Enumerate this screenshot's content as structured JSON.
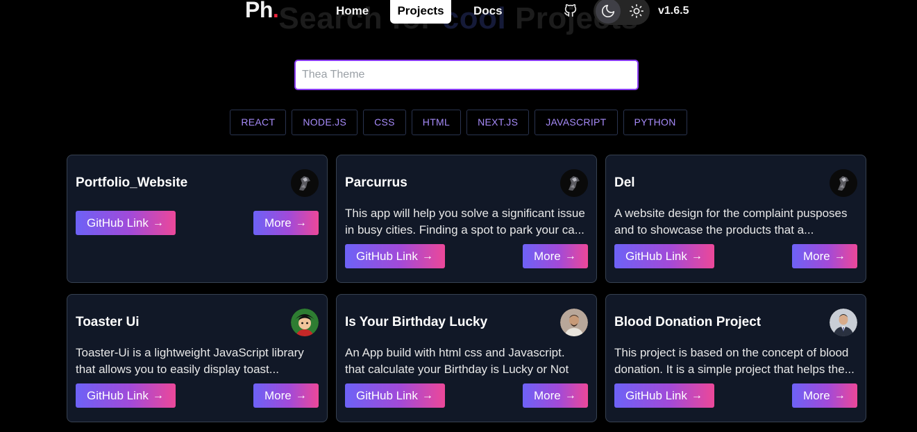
{
  "nav": {
    "logo": "Ph",
    "logo_dot": ".",
    "links": [
      "Home",
      "Projects",
      "Docs"
    ],
    "version": "v1.6.5"
  },
  "background_heading": {
    "part1": "Search for ",
    "part2": "cool",
    "part3": " Projects"
  },
  "search": {
    "placeholder": "Thea Theme",
    "value": ""
  },
  "tags": [
    "REACT",
    "NODE.JS",
    "CSS",
    "HTML",
    "NEXT.JS",
    "JAVASCRIPT",
    "PYTHON"
  ],
  "buttons": {
    "github": "GitHub Link",
    "more": "More",
    "arrow": "→"
  },
  "cards": [
    {
      "title": "Portfolio_Website",
      "description": "",
      "avatar": "dark-horse-avatar"
    },
    {
      "title": "Parcurrus",
      "description": "This app will help you solve a significant issue in busy cities. Finding a spot to park your ca...",
      "avatar": "dark-horse-avatar"
    },
    {
      "title": "Del",
      "description": "A website design for the complaint pusposes and to showcase the products that a...",
      "avatar": "dark-horse-avatar"
    },
    {
      "title": "Toaster Ui",
      "description": "Toaster-Ui is a lightweight JavaScript library that allows you to easily display toast...",
      "avatar": "anime-avatar"
    },
    {
      "title": "Is Your Birthday Lucky",
      "description": "An App build with html css and Javascript. that calculate your Birthday is Lucky or Not",
      "avatar": "person-avatar"
    },
    {
      "title": "Blood Donation Project",
      "description": "This project is based on the concept of blood donation. It is a simple project that helps the...",
      "avatar": "person-suit-avatar"
    }
  ],
  "colors": {
    "accent": "#8b3df5",
    "tag_text": "#a78bfa",
    "card_bg": "#111827",
    "gradient_start": "#6d62f6",
    "gradient_end": "#ec4899"
  }
}
